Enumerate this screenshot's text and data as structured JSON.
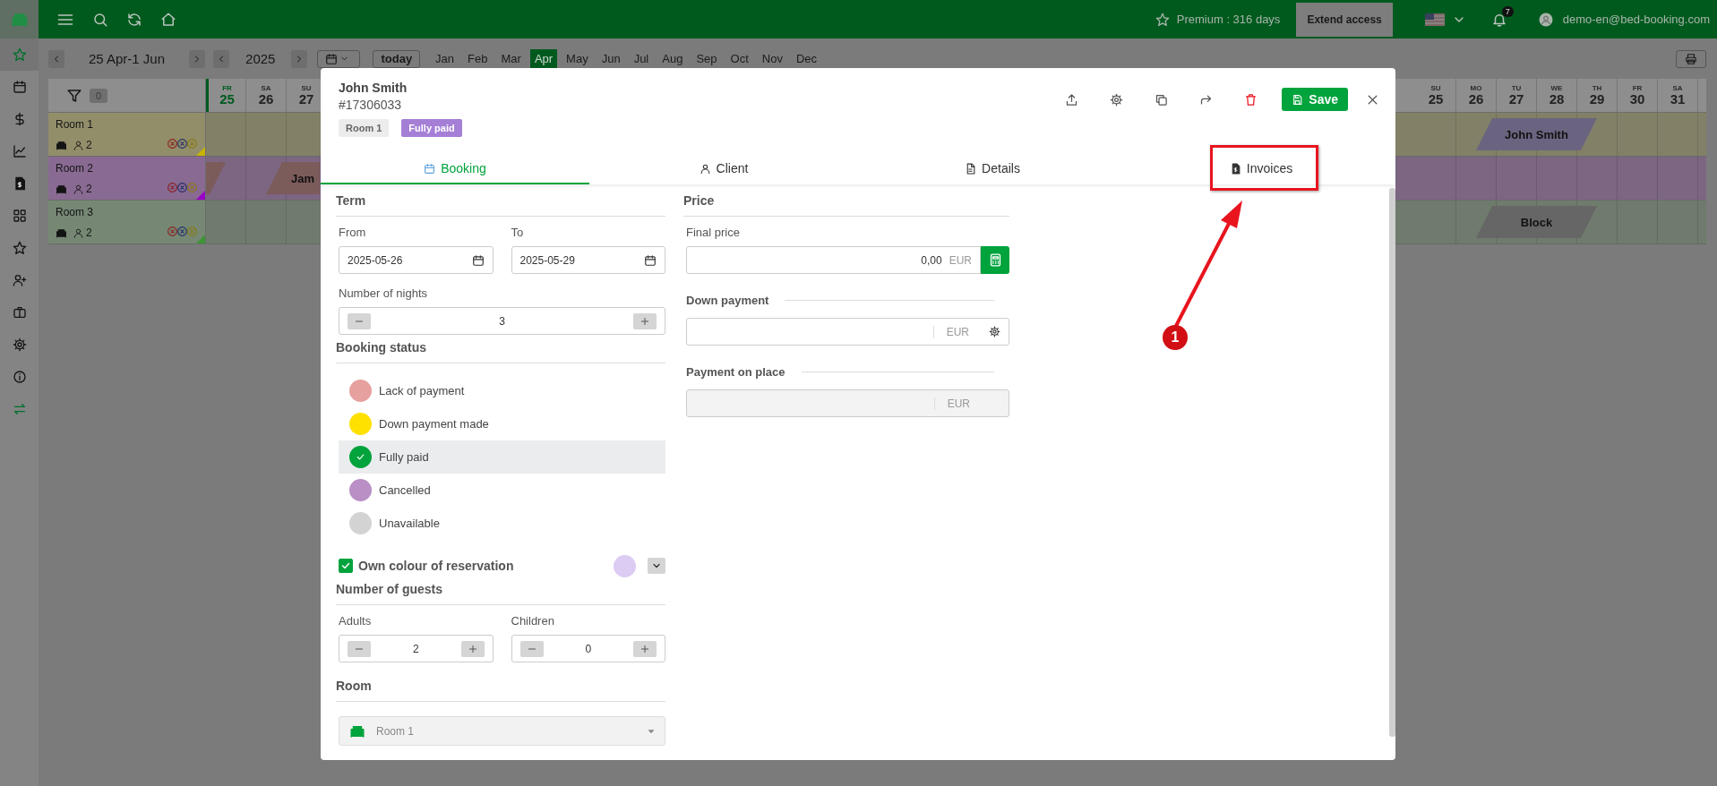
{
  "top_bar": {
    "premium": "Premium : 316 days",
    "extend_button": "Extend access",
    "notification_count": "7",
    "user_email": "demo-en@bed-booking.com"
  },
  "sidebar": {
    "items": [
      {
        "selected": true,
        "accent": false
      },
      {
        "selected": false,
        "accent": false
      },
      {
        "selected": false,
        "accent": false
      },
      {
        "selected": false,
        "accent": false
      },
      {
        "selected": false,
        "accent": false
      },
      {
        "selected": false,
        "accent": false
      },
      {
        "selected": false,
        "accent": false
      },
      {
        "selected": false,
        "accent": false
      },
      {
        "selected": false,
        "accent": false
      },
      {
        "selected": false,
        "accent": false
      },
      {
        "selected": false,
        "accent": false
      },
      {
        "selected": false,
        "accent": true
      }
    ]
  },
  "toolbar": {
    "range": "25 Apr-1 Jun",
    "year": "2025",
    "today_button": "today",
    "months": [
      {
        "label": "Jan",
        "selected": false
      },
      {
        "label": "Feb",
        "selected": false
      },
      {
        "label": "Mar",
        "selected": false
      },
      {
        "label": "Apr",
        "selected": true
      },
      {
        "label": "May",
        "selected": false
      },
      {
        "label": "Jun",
        "selected": false
      },
      {
        "label": "Jul",
        "selected": false
      },
      {
        "label": "Aug",
        "selected": false
      },
      {
        "label": "Sep",
        "selected": false
      },
      {
        "label": "Oct",
        "selected": false
      },
      {
        "label": "Nov",
        "selected": false
      },
      {
        "label": "Dec",
        "selected": false
      }
    ]
  },
  "calendar": {
    "filter_count": "0",
    "days_left": [
      {
        "weekday": "FR",
        "day": "25",
        "today": true
      },
      {
        "weekday": "SA",
        "day": "26",
        "today": false
      },
      {
        "weekday": "SU",
        "day": "27",
        "today": false
      }
    ],
    "days_right": [
      {
        "weekday": "SU",
        "day": "25",
        "today": false
      },
      {
        "weekday": "MO",
        "day": "26",
        "today": false
      },
      {
        "weekday": "TU",
        "day": "27",
        "today": false
      },
      {
        "weekday": "WE",
        "day": "28",
        "today": false
      },
      {
        "weekday": "TH",
        "day": "29",
        "today": false
      },
      {
        "weekday": "FR",
        "day": "30",
        "today": false
      },
      {
        "weekday": "SA",
        "day": "31",
        "today": false
      }
    ],
    "rooms": [
      {
        "name": "Room 1",
        "guests": "2",
        "color": "#c8b400",
        "cells_right": [
          {
            "kind": "free"
          },
          {
            "kind": "start"
          },
          {
            "kind": "inside"
          },
          {
            "kind": "inside"
          },
          {
            "kind": "end"
          },
          {
            "kind": "free"
          },
          {
            "kind": "free"
          }
        ],
        "bookings_right": [
          {
            "label": "John Smith",
            "color": "#6b6480"
          }
        ]
      },
      {
        "name": "Room 2",
        "guests": "2",
        "color": "#9b00c8",
        "cells_left": [
          {
            "kind": "end"
          },
          {
            "kind": "start"
          },
          {
            "kind": "inside"
          }
        ],
        "bookings_left": [
          {
            "color": "#7c5b5b"
          },
          {
            "label": "Jam",
            "color": "#7c5b5b"
          }
        ]
      },
      {
        "name": "Room 3",
        "guests": "2",
        "color": "#3c9632",
        "cells_right": [
          {
            "kind": "free"
          },
          {
            "kind": "start"
          },
          {
            "kind": "inside"
          },
          {
            "kind": "inside"
          },
          {
            "kind": "end"
          },
          {
            "kind": "free"
          },
          {
            "kind": "free"
          }
        ],
        "bookings_right": [
          {
            "label": "Block",
            "color": "#666666"
          }
        ]
      }
    ]
  },
  "booking_dialog": {
    "guest_name": "John Smith",
    "booking_number": "#17306033",
    "tags": [
      {
        "label": "Room 1",
        "kind": "room"
      },
      {
        "label": "Fully paid",
        "kind": "status"
      }
    ],
    "save_button": "Save",
    "tabs": [
      {
        "label": "Booking",
        "selected": true
      },
      {
        "label": "Client",
        "selected": false
      },
      {
        "label": "Details",
        "selected": false
      },
      {
        "label": "Invoices",
        "selected": false
      }
    ],
    "term": {
      "title": "Term",
      "from_label": "From",
      "from_value": "2025-05-26",
      "to_label": "To",
      "to_value": "2025-05-29",
      "nights_label": "Number of nights",
      "nights_value": "3"
    },
    "booking_status": {
      "title": "Booking status",
      "options": [
        {
          "label": "Lack of payment",
          "color": "#e6a09e",
          "selected": false
        },
        {
          "label": "Down payment made",
          "color": "#ffe100",
          "selected": false
        },
        {
          "label": "Fully paid",
          "color": "#00a33c",
          "selected": true
        },
        {
          "label": "Cancelled",
          "color": "#b98fc6",
          "selected": false
        },
        {
          "label": "Unavailable",
          "color": "#d3d3d3",
          "selected": false
        }
      ]
    },
    "own_colour": {
      "label": "Own colour of reservation",
      "checked": true,
      "color": "#dccbf2"
    },
    "guests": {
      "title": "Number of guests",
      "adults_label": "Adults",
      "adults_value": "2",
      "children_label": "Children",
      "children_value": "0"
    },
    "room": {
      "title": "Room",
      "value": "Room 1"
    },
    "price": {
      "title": "Price",
      "final_price_label": "Final price",
      "final_price_value": "0,00",
      "final_price_currency": "EUR",
      "down_payment_label": "Down payment",
      "down_payment_currency": "EUR",
      "payment_on_place_label": "Payment on place",
      "payment_on_place_currency": "EUR",
      "payment_on_place_disabled": true
    }
  },
  "annotation": {
    "label": "1"
  }
}
